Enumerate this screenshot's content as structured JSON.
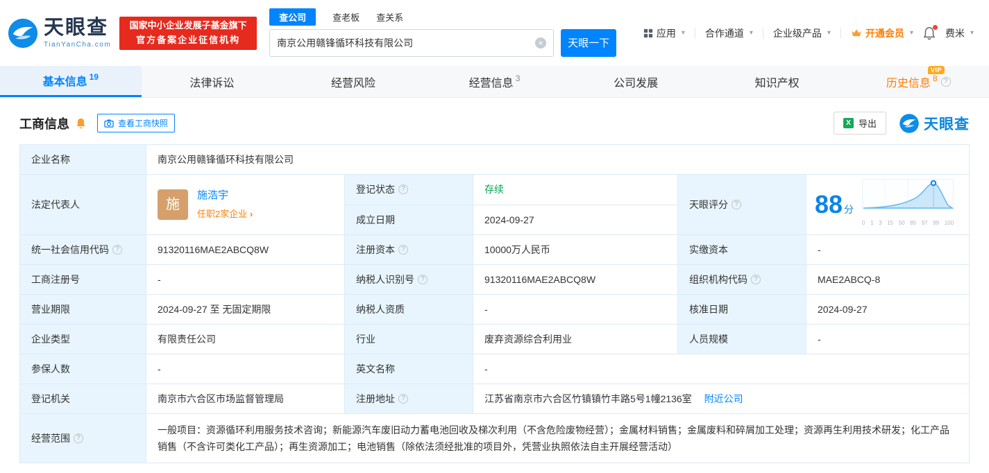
{
  "header": {
    "logo": {
      "brand": "天眼查",
      "domain": "TianYanCha.com"
    },
    "badge": {
      "line1": "国家中小企业发展子基金旗下",
      "line2": "官方备案企业征信机构"
    },
    "search_tabs": {
      "company": "查公司",
      "boss": "查老板",
      "relation": "查关系"
    },
    "search": {
      "value": "南京公用赣锋循环科技有限公司",
      "button": "天眼一下"
    },
    "nav": {
      "apps": "应用",
      "coop": "合作通道",
      "products": "企业级产品",
      "vip": "开通会员",
      "user": "费米"
    }
  },
  "tabs": {
    "basic": {
      "label": "基本信息",
      "count": "19"
    },
    "legal": {
      "label": "法律诉讼"
    },
    "risk": {
      "label": "经营风险"
    },
    "business": {
      "label": "经营信息",
      "count": "3"
    },
    "development": {
      "label": "公司发展"
    },
    "ip": {
      "label": "知识产权"
    },
    "history": {
      "label": "历史信息",
      "count": "8",
      "vip": "VIP"
    }
  },
  "section": {
    "title": "工商信息",
    "snapshot": "查看工商快照",
    "export": "导出",
    "brand": "天眼查"
  },
  "info": {
    "company_name": {
      "label": "企业名称",
      "value": "南京公用赣锋循环科技有限公司"
    },
    "legal_rep": {
      "label": "法定代表人",
      "avatar": "施",
      "name": "施浩宇",
      "note": "任职2家企业"
    },
    "reg_status": {
      "label": "登记状态",
      "value": "存续"
    },
    "establish_date": {
      "label": "成立日期",
      "value": "2024-09-27"
    },
    "score": {
      "label": "天眼评分",
      "value": "88",
      "unit": "分",
      "ticks": [
        "0",
        "1",
        "3",
        "15",
        "50",
        "85",
        "97",
        "99",
        "100"
      ]
    },
    "credit_code": {
      "label": "统一社会信用代码",
      "value": "91320116MAE2ABCQ8W"
    },
    "reg_capital": {
      "label": "注册资本",
      "value": "10000万人民币"
    },
    "paid_capital": {
      "label": "实缴资本",
      "value": "-"
    },
    "reg_number": {
      "label": "工商注册号",
      "value": "-"
    },
    "taxpayer_id": {
      "label": "纳税人识别号",
      "value": "91320116MAE2ABCQ8W"
    },
    "org_code": {
      "label": "组织机构代码",
      "value": "MAE2ABCQ-8"
    },
    "business_term": {
      "label": "营业期限",
      "value": "2024-09-27 至 无固定期限"
    },
    "taxpayer_quality": {
      "label": "纳税人资质",
      "value": "-"
    },
    "approval_date": {
      "label": "核准日期",
      "value": "2024-09-27"
    },
    "company_type": {
      "label": "企业类型",
      "value": "有限责任公司"
    },
    "industry": {
      "label": "行业",
      "value": "废弃资源综合利用业"
    },
    "staff_size": {
      "label": "人员规模",
      "value": "-"
    },
    "insured_count": {
      "label": "参保人数",
      "value": "-"
    },
    "english_name": {
      "label": "英文名称",
      "value": "-"
    },
    "reg_authority": {
      "label": "登记机关",
      "value": "南京市六合区市场监督管理局"
    },
    "reg_address": {
      "label": "注册地址",
      "value": "江苏省南京市六合区竹镇镇竹丰路5号1幢2136室",
      "link": "附近公司"
    },
    "business_scope": {
      "label": "经营范围",
      "value": "一般项目：资源循环利用服务技术咨询；新能源汽车废旧动力蓄电池回收及梯次利用（不含危险废物经营）；金属材料销售；金属废料和碎屑加工处理；资源再生利用技术研发；化工产品销售（不含许可类化工产品）；再生资源加工；电池销售（除依法须经批准的项目外，凭营业执照依法自主开展经营活动）"
    }
  }
}
